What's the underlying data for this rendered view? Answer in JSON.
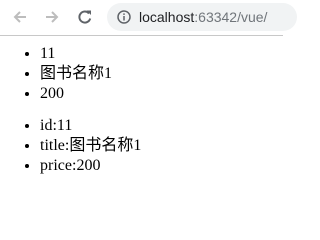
{
  "browser": {
    "url_host": "localhost",
    "url_rest": ":63342/vue/"
  },
  "list_values": [
    "11",
    "图书名称1",
    "200"
  ],
  "list_entries": [
    {
      "key": "id",
      "value": "11"
    },
    {
      "key": "title",
      "value": "图书名称1"
    },
    {
      "key": "price",
      "value": "200"
    }
  ],
  "icons": {
    "back": "arrow-left-icon",
    "forward": "arrow-right-icon",
    "reload": "reload-icon",
    "site_info": "info-circle-icon"
  },
  "colors": {
    "toolbar_icon": "#bdbdbd",
    "toolbar_icon_active": "#5f6368",
    "omnibox_bg": "#f1f3f4",
    "url_host": "#202124",
    "url_rest": "#70757a"
  }
}
